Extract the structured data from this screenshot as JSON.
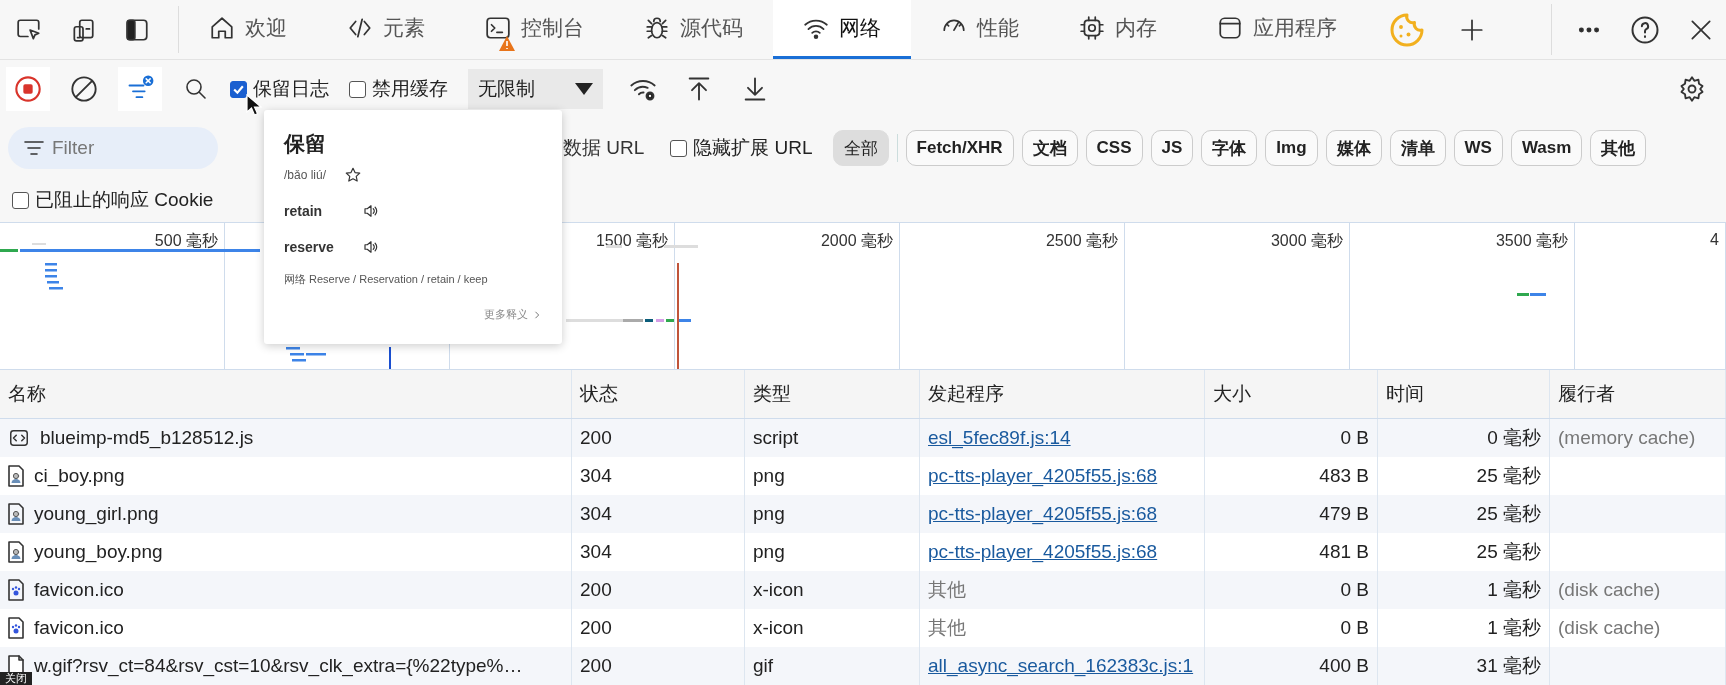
{
  "tabs": [
    {
      "label": "欢迎",
      "selected": false,
      "warning": false
    },
    {
      "label": "元素",
      "selected": false,
      "warning": false
    },
    {
      "label": "控制台",
      "selected": false,
      "warning": true
    },
    {
      "label": "源代码",
      "selected": false,
      "warning": false
    },
    {
      "label": "网络",
      "selected": true,
      "warning": false
    },
    {
      "label": "性能",
      "selected": false,
      "warning": false
    },
    {
      "label": "内存",
      "selected": false,
      "warning": false
    },
    {
      "label": "应用程序",
      "selected": false,
      "warning": false
    }
  ],
  "toolbar": {
    "preserve_log": {
      "label": "保留日志",
      "checked": true
    },
    "disable_cache": {
      "label": "禁用缓存",
      "checked": false
    },
    "throttling": {
      "value": "无限制"
    }
  },
  "filter": {
    "placeholder": "Filter"
  },
  "data_url": {
    "label": "数据 URL"
  },
  "hide_extension_url": {
    "label": "隐藏扩展 URL",
    "checked": false
  },
  "type_filters": [
    {
      "label": "全部",
      "selected": true
    },
    {
      "label": "Fetch/XHR",
      "selected": false
    },
    {
      "label": "文档",
      "selected": false
    },
    {
      "label": "CSS",
      "selected": false
    },
    {
      "label": "JS",
      "selected": false
    },
    {
      "label": "字体",
      "selected": false
    },
    {
      "label": "Img",
      "selected": false
    },
    {
      "label": "媒体",
      "selected": false
    },
    {
      "label": "清单",
      "selected": false
    },
    {
      "label": "WS",
      "selected": false
    },
    {
      "label": "Wasm",
      "selected": false
    },
    {
      "label": "其他",
      "selected": false
    }
  ],
  "blocked_cookies": {
    "label": "已阻止的响应 Cookie",
    "checked": false
  },
  "overview": {
    "columns": [
      {
        "label": "500 毫秒"
      },
      {},
      {
        "label": "1500 毫秒"
      },
      {
        "label": "2000 毫秒"
      },
      {
        "label": "2500 毫秒"
      },
      {
        "label": "3000 毫秒"
      },
      {
        "label": "3500 毫秒"
      },
      {
        "label": "4"
      }
    ]
  },
  "popup": {
    "word": "保留",
    "pinyin": "/bǎo liú/",
    "senses": [
      "retain",
      "reserve"
    ],
    "web": "网络 Reserve / Reservation / retain / keep",
    "more": "更多释义"
  },
  "table": {
    "columns": [
      "名称",
      "状态",
      "类型",
      "发起程序",
      "大小",
      "时间",
      "履行者"
    ],
    "rows": [
      {
        "kind": "script",
        "name": "blueimp-md5_b128512.js",
        "status": "200",
        "type": "script",
        "initiator": {
          "text": "esl_5fec89f.js:14",
          "kind": "link"
        },
        "size": "0 B",
        "time": "0 毫秒",
        "fulfilled_by": "(memory cache)"
      },
      {
        "kind": "image",
        "name": "ci_boy.png",
        "status": "304",
        "type": "png",
        "initiator": {
          "text": "pc-tts-player_4205f55.js:68",
          "kind": "link"
        },
        "size": "483 B",
        "time": "25 毫秒"
      },
      {
        "kind": "image",
        "name": "young_girl.png",
        "status": "304",
        "type": "png",
        "initiator": {
          "text": "pc-tts-player_4205f55.js:68",
          "kind": "link"
        },
        "size": "479 B",
        "time": "25 毫秒"
      },
      {
        "kind": "image",
        "name": "young_boy.png",
        "status": "304",
        "type": "png",
        "initiator": {
          "text": "pc-tts-player_4205f55.js:68",
          "kind": "link"
        },
        "size": "481 B",
        "time": "25 毫秒"
      },
      {
        "kind": "favicon",
        "name": "favicon.ico",
        "status": "200",
        "type": "x-icon",
        "initiator": {
          "text": "其他",
          "kind": "other"
        },
        "size": "0 B",
        "time": "1 毫秒",
        "fulfilled_by": "(disk cache)"
      },
      {
        "kind": "favicon",
        "name": "favicon.ico",
        "status": "200",
        "type": "x-icon",
        "initiator": {
          "text": "其他",
          "kind": "other"
        },
        "size": "0 B",
        "time": "1 毫秒",
        "fulfilled_by": "(disk cache)"
      },
      {
        "kind": "file",
        "name": "w.gif?rsv_ct=84&rsv_cst=10&rsv_clk_extra={%22type%…",
        "status": "200",
        "type": "gif",
        "initiator": {
          "text": "all_async_search_162383c.js:1",
          "kind": "link"
        },
        "size": "400 B",
        "time": "31 毫秒"
      }
    ]
  },
  "tooltip": {
    "text": "关闭"
  }
}
